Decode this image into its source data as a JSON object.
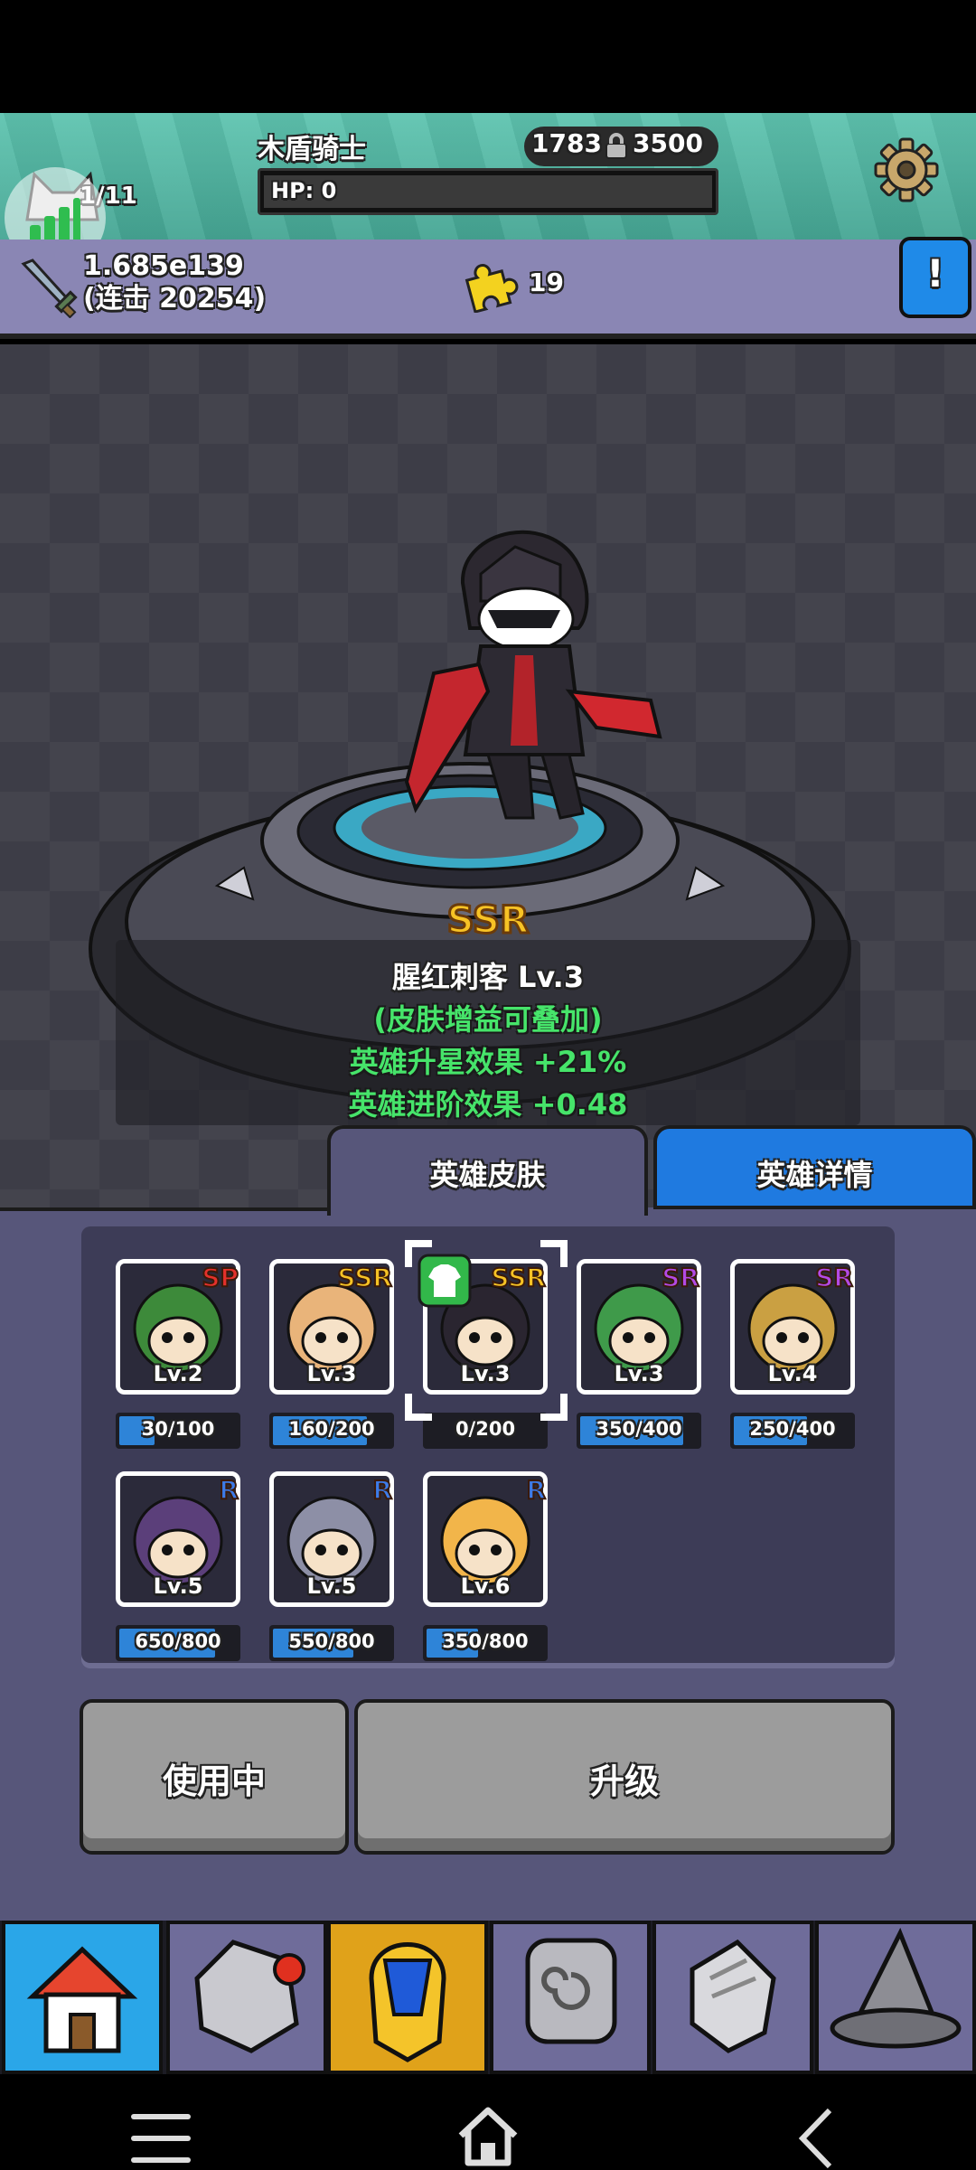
{
  "header": {
    "stage_name": "木盾骑士",
    "gold_left": "1783",
    "gold_right": "3500",
    "hp_label": "HP: 0",
    "wave": "1/11"
  },
  "stats": {
    "damage": "1.685e139",
    "combo": "(连击 20254)",
    "puzzle_count": "19",
    "info_label": "!"
  },
  "hero": {
    "rarity": "SSR",
    "name": "腥红刺客 Lv.3",
    "stack_note": "(皮肤增益可叠加)",
    "star_effect": "英雄升星效果 +21%",
    "advance_effect": "英雄进阶效果 +0.48"
  },
  "tabs": {
    "skin": "英雄皮肤",
    "detail": "英雄详情"
  },
  "skins": [
    {
      "rarity": "SP",
      "level": "Lv.2",
      "progress": "30/100",
      "fill": 0.3
    },
    {
      "rarity": "SSR",
      "level": "Lv.3",
      "progress": "160/200",
      "fill": 0.8
    },
    {
      "rarity": "SSR",
      "level": "Lv.3",
      "progress": "0/200",
      "fill": 0.0
    },
    {
      "rarity": "SR",
      "level": "Lv.3",
      "progress": "350/400",
      "fill": 0.875
    },
    {
      "rarity": "SR",
      "level": "Lv.4",
      "progress": "250/400",
      "fill": 0.625
    },
    {
      "rarity": "R",
      "level": "Lv.5",
      "progress": "650/800",
      "fill": 0.8125
    },
    {
      "rarity": "R",
      "level": "Lv.5",
      "progress": "550/800",
      "fill": 0.6875
    },
    {
      "rarity": "R",
      "level": "Lv.6",
      "progress": "350/800",
      "fill": 0.4375
    }
  ],
  "buttons": {
    "in_use": "使用中",
    "upgrade": "升级"
  },
  "colors": {
    "teal_header": "#5fc4b0",
    "panel_purple": "#57567a",
    "tab_blue": "#1f7ae0",
    "nav_active": "#2aa6e8",
    "nav_selected": "#e0a21a",
    "effect_green": "#46e46a",
    "ssr_gold": "#f7c325"
  }
}
